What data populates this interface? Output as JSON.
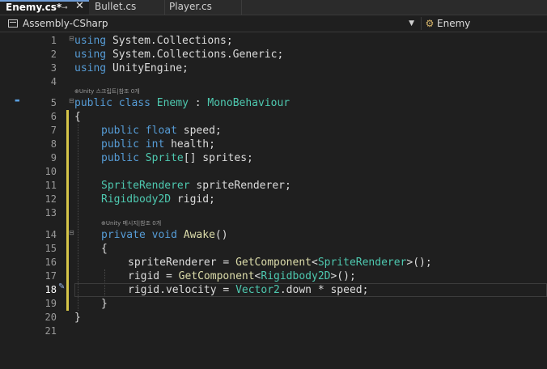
{
  "tabs": [
    {
      "label": "Enemy.cs*",
      "active": true
    },
    {
      "label": "Bullet.cs",
      "active": false
    },
    {
      "label": "Player.cs",
      "active": false
    }
  ],
  "tab_controls": {
    "pin_icon": "⊸",
    "close_icon": "✕"
  },
  "navbar": {
    "project": "Assembly-CSharp",
    "type_icon": "class-icon",
    "type": "Enemy"
  },
  "codelens": {
    "class": "⊕Unity 스크립트|참조 0개",
    "method": "⊕Unity 메시지|참조 0개"
  },
  "line_numbers": [
    "1",
    "2",
    "3",
    "4",
    "5",
    "6",
    "7",
    "8",
    "9",
    "10",
    "11",
    "12",
    "13",
    "14",
    "15",
    "16",
    "17",
    "18",
    "19",
    "20",
    "21"
  ],
  "current_line": "18",
  "code": {
    "l1": {
      "kw": "using",
      "rest": " System.Collections;"
    },
    "l2": {
      "kw": "using",
      "rest": " System.Collections.Generic;"
    },
    "l3": {
      "kw": "using",
      "rest": " UnityEngine;"
    },
    "l5": {
      "kw1": "public",
      "kw2": "class",
      "name": "Enemy",
      "colon": " : ",
      "base": "MonoBehaviour"
    },
    "l6": "{",
    "l7": {
      "kw1": "public",
      "kw2": "float",
      "rest": " speed;"
    },
    "l8": {
      "kw1": "public",
      "kw2": "int",
      "rest": " health;"
    },
    "l9": {
      "kw1": "public",
      "ty": "Sprite",
      "rest": "[] sprites;"
    },
    "l11": {
      "ty": "SpriteRenderer",
      "rest": " spriteRenderer;"
    },
    "l12": {
      "ty": "Rigidbody2D",
      "rest": " rigid;"
    },
    "l14": {
      "kw1": "private",
      "kw2": "void",
      "fn": "Awake",
      "rest": "()"
    },
    "l15": "{",
    "l16": {
      "a": "spriteRenderer = ",
      "fn": "GetComponent",
      "lt": "<",
      "ty": "SpriteRenderer",
      "gt": ">();"
    },
    "l17": {
      "a": "rigid = ",
      "fn": "GetComponent",
      "lt": "<",
      "ty": "Rigidbody2D",
      "gt": ">();"
    },
    "l18": {
      "a": "rigid.velocity = ",
      "ty": "Vector2",
      "rest": ".down * speed;"
    },
    "l19": "}",
    "l20": "}"
  },
  "colors": {
    "keyword": "#569cd6",
    "type": "#4ec9b0",
    "method": "#dcdcaa",
    "background": "#1f1f1f"
  }
}
